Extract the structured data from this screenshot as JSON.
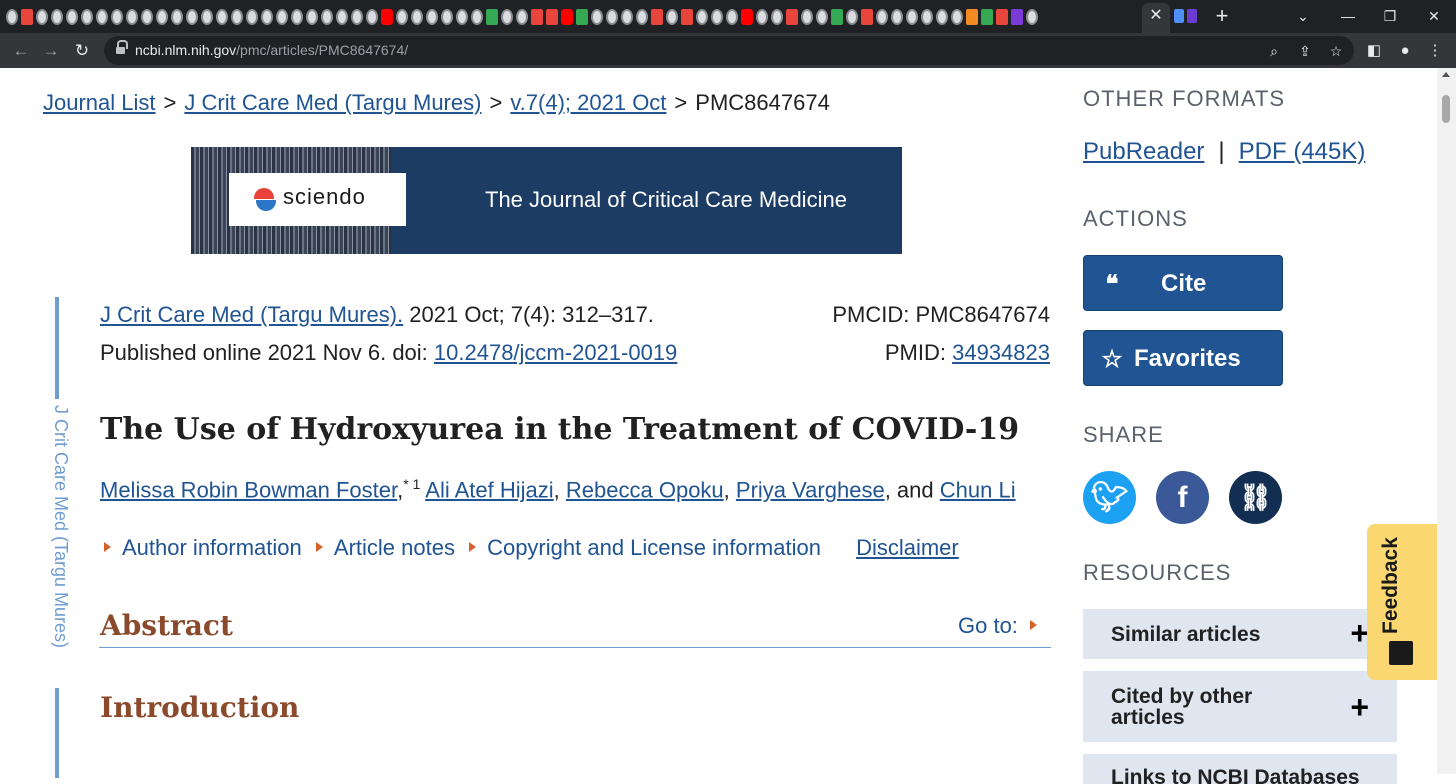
{
  "browser": {
    "url_host": "ncbi.nlm.nih.gov",
    "url_path": "/pmc/articles/PMC8647674/",
    "tab_close": "✕",
    "new_tab": "+"
  },
  "breadcrumb": {
    "items": [
      "Journal List",
      "J Crit Care Med (Targu Mures)",
      "v.7(4); 2021 Oct"
    ],
    "current": "PMC8647674",
    "separator": ">"
  },
  "banner": {
    "logo": "sciendo",
    "journal": "The Journal of Critical Care Medicine"
  },
  "side_label": "J Crit Care Med (Targu Mures)",
  "citation": {
    "journal_link": "J Crit Care Med (Targu Mures).",
    "issue": " 2021 Oct; 7(4): 312–317.",
    "published": "Published online 2021 Nov 6. doi: ",
    "doi": "10.2478/jccm-2021-0019",
    "pmcid_label": "PMCID: PMC8647674",
    "pmid_label": "PMID: ",
    "pmid": "34934823"
  },
  "article": {
    "title": "The Use of Hydroxyurea in the Treatment of COVID-19",
    "authors": [
      "Melissa Robin Bowman Foster",
      "Ali Atef Hijazi",
      "Rebecca Opoku",
      "Priya Varghese",
      "Chun Li"
    ],
    "author_mark": "* 1",
    "and": "and"
  },
  "meta_links": {
    "author_info": "Author information",
    "article_notes": "Article notes",
    "copyright": "Copyright and License information",
    "disclaimer": "Disclaimer"
  },
  "sections": {
    "abstract": "Abstract",
    "goto": "Go to:",
    "introduction": "Introduction"
  },
  "sidebar": {
    "other_formats": "OTHER FORMATS",
    "pubreader": "PubReader",
    "pdf": "PDF (445K)",
    "actions": "ACTIONS",
    "cite": "Cite",
    "favorites": "Favorites",
    "share": "SHARE",
    "resources": "RESOURCES",
    "similar": "Similar articles",
    "cited_by_1": "Cited by other",
    "cited_by_2": "articles",
    "links_ncbi": "Links to NCBI Databases"
  },
  "feedback": "Feedback",
  "colors": {
    "link": "#205493",
    "accent_heading": "#8a4a2b",
    "twitter": "#1da1f2",
    "facebook": "#3b5998",
    "link_share": "#122e51",
    "feedback_bg": "#fbd771"
  }
}
